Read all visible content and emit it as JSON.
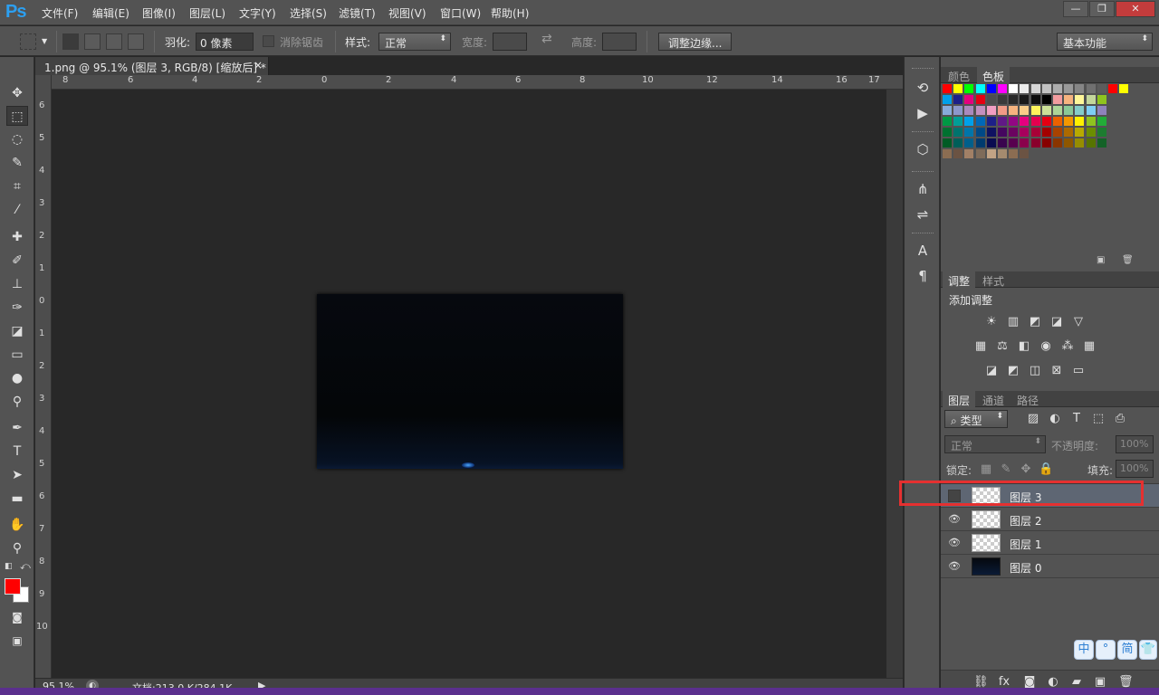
{
  "app": {
    "logo": "Ps"
  },
  "menu": [
    "文件(F)",
    "编辑(E)",
    "图像(I)",
    "图层(L)",
    "文字(Y)",
    "选择(S)",
    "滤镜(T)",
    "视图(V)",
    "窗口(W)",
    "帮助(H)"
  ],
  "window_controls": {
    "minimize": "—",
    "restore": "❐",
    "close": "✕"
  },
  "options": {
    "feather_label": "羽化:",
    "feather_value": "0 像素",
    "antialias_label": "消除锯齿",
    "style_label": "样式:",
    "style_value": "正常",
    "width_label": "宽度:",
    "height_label": "高度:",
    "refine_edge": "调整边缘...",
    "workspace": "基本功能"
  },
  "document": {
    "tab_title": "1.png @ 95.1% (图层 3, RGB/8) [缩放后] *",
    "close": "×",
    "ruler_h": [
      "8",
      "6",
      "4",
      "2",
      "0",
      "2",
      "4",
      "6",
      "8",
      "10",
      "12",
      "14",
      "16",
      "17"
    ],
    "ruler_v": [
      "6",
      "5",
      "4",
      "3",
      "2",
      "1",
      "0",
      "1",
      "2",
      "3",
      "4",
      "5",
      "6",
      "7",
      "8",
      "9",
      "10"
    ]
  },
  "status": {
    "zoom": "95.1%",
    "doc_info": "文档:213.0 K/284.1K"
  },
  "panels": {
    "color_tabs": [
      "颜色",
      "色板"
    ],
    "adjust_tabs": [
      "调整",
      "样式"
    ],
    "add_adjustment": "添加调整",
    "layer_tabs": [
      "图层",
      "通道",
      "路径"
    ],
    "filter_kind": "类型",
    "blend_mode": "正常",
    "opacity_label": "不透明度:",
    "opacity_value": "100%",
    "lock_label": "锁定:",
    "fill_label": "填充:",
    "fill_value": "100%",
    "layers": [
      {
        "name": "图层 3",
        "visible": false,
        "selected": true,
        "thumb": "transparent"
      },
      {
        "name": "图层 2",
        "visible": true,
        "selected": false,
        "thumb": "transparent"
      },
      {
        "name": "图层 1",
        "visible": true,
        "selected": false,
        "thumb": "transparent"
      },
      {
        "name": "图层 0",
        "visible": true,
        "selected": false,
        "thumb": "dark"
      }
    ]
  },
  "ime": [
    "中",
    "°",
    "简",
    "👕"
  ],
  "colors": {
    "foreground": "#ff0000",
    "background": "#ffffff",
    "highlight": "#e53030",
    "accent": "#2c9ff0"
  }
}
